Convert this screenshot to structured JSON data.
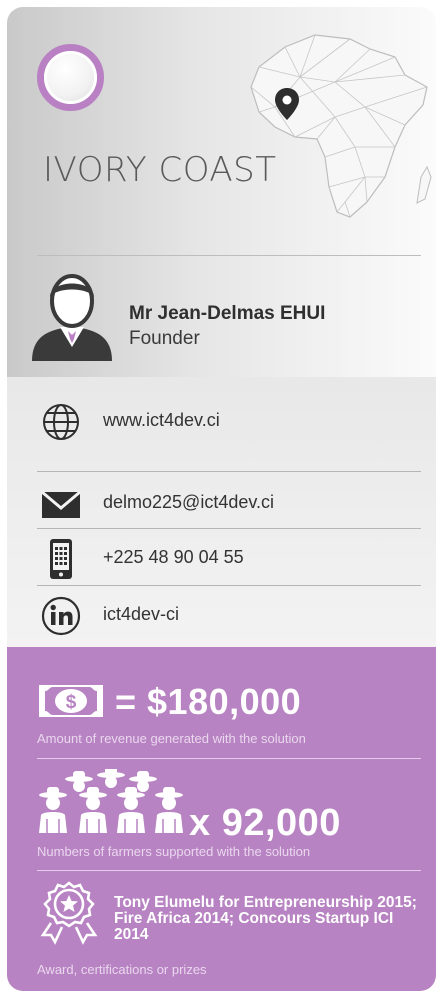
{
  "header": {
    "country": "IVORY COAST"
  },
  "person": {
    "name": "Mr Jean-Delmas EHUI",
    "role": "Founder"
  },
  "contacts": {
    "website": "www.ict4dev.ci",
    "email": "delmo225@ict4dev.ci",
    "phone": "+225 48 90 04 55",
    "linkedin": "ict4dev-ci"
  },
  "stats": {
    "revenue_value": "= $180,000",
    "revenue_caption": "Amount of revenue generated with the solution",
    "farmers_value": "x 92,000",
    "farmers_caption": "Numbers of farmers supported with the solution",
    "award_text": "Tony Elumelu for Entrepreneurship 2015; Fire Africa 2014; Concours Startup ICI 2014",
    "award_caption": "Award, certifications or prizes"
  },
  "colors": {
    "accent_purple": "#b883c2",
    "ring_purple": "#b981c4",
    "header_gray": "#e6e6e6"
  },
  "icons": [
    "globe-icon",
    "mail-icon",
    "phone-icon",
    "linkedin-icon",
    "money-icon",
    "farmers-icon",
    "award-icon",
    "location-pin-icon"
  ]
}
